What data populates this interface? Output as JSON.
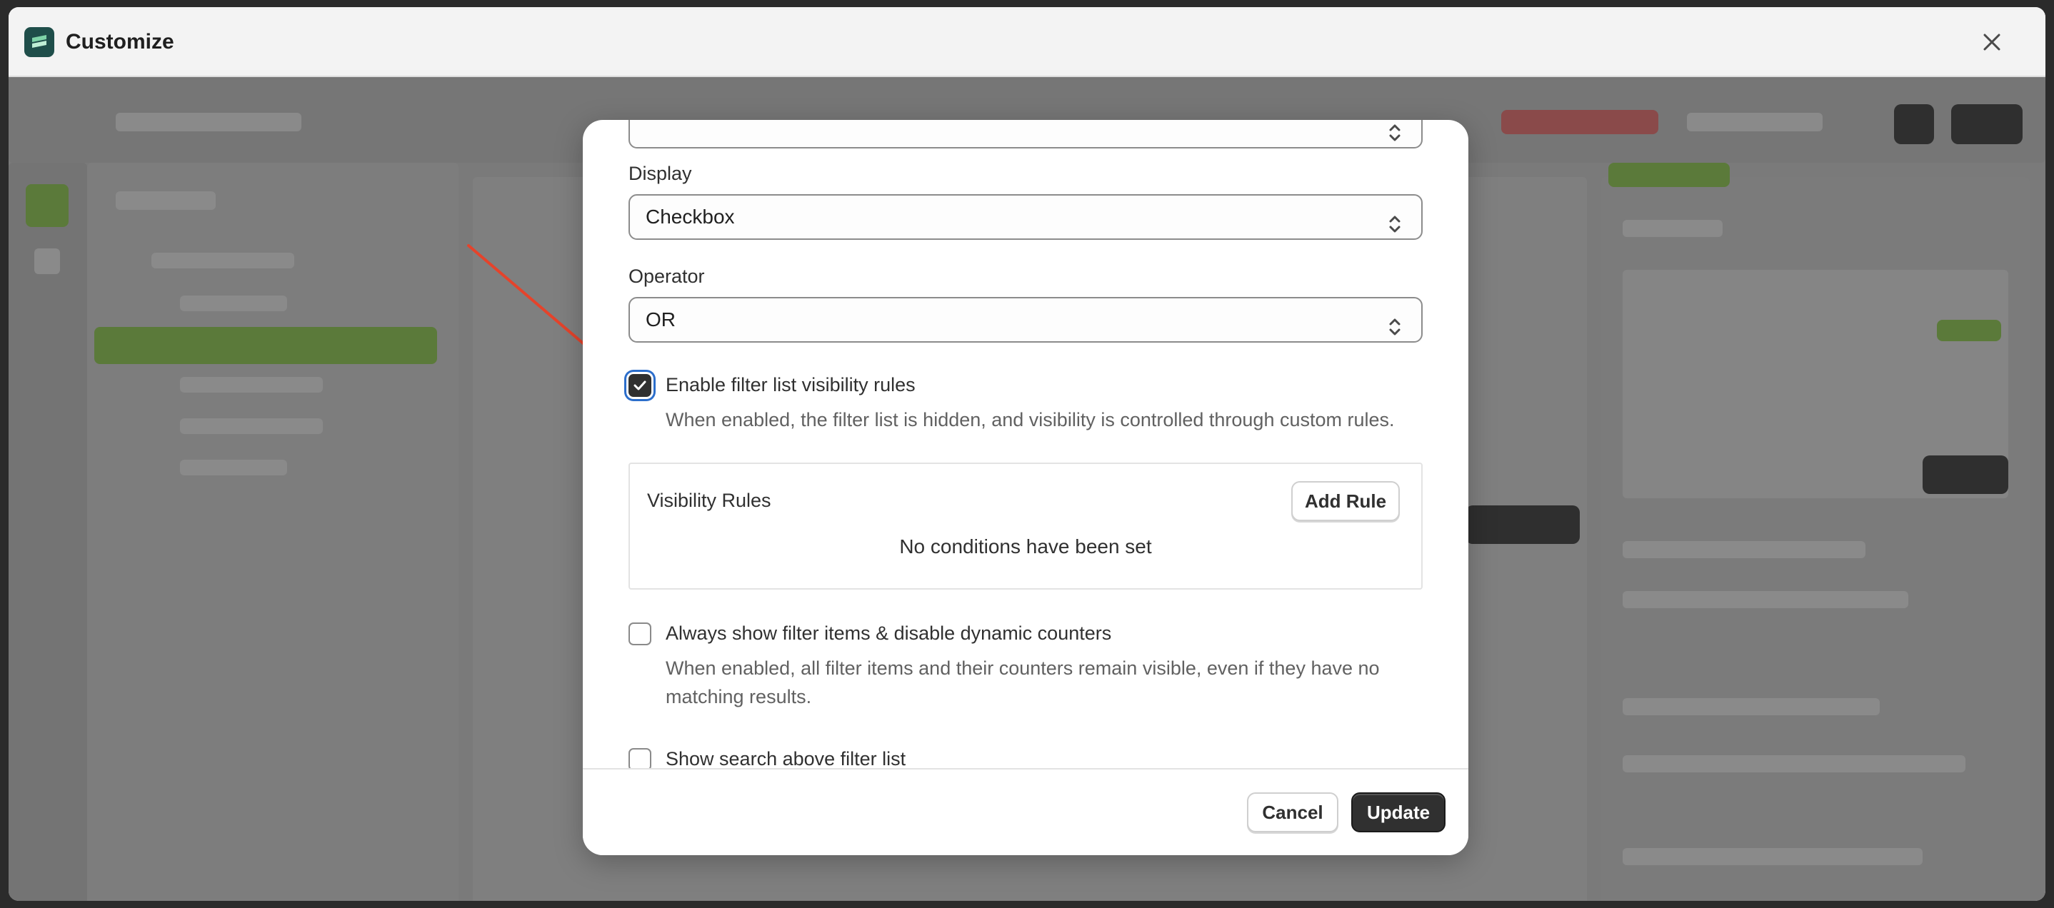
{
  "window": {
    "title": "Customize",
    "close_icon": "close-icon",
    "logo_icon": "app-logo-icon"
  },
  "modal": {
    "fields": {
      "display_label": "Display",
      "display_value": "Checkbox",
      "operator_label": "Operator",
      "operator_value": "OR"
    },
    "visibility_checkbox": {
      "label": "Enable filter list visibility rules",
      "checked": true,
      "help": "When enabled, the filter list is hidden, and visibility is controlled through custom rules."
    },
    "visibility_rules": {
      "title": "Visibility Rules",
      "add_button": "Add Rule",
      "empty_text": "No conditions have been set"
    },
    "always_show_checkbox": {
      "label": "Always show filter items & disable dynamic counters",
      "checked": false,
      "help": "When enabled, all filter items and their counters remain visible, even if they have no matching results."
    },
    "search_checkbox": {
      "label": "Show search above filter list",
      "checked": false
    },
    "footer": {
      "cancel": "Cancel",
      "update": "Update"
    }
  },
  "colors": {
    "annotation_arrow": "#e5432b",
    "focus_ring": "#2c6ecb",
    "primary_button": "#303030",
    "app_logo": "#1f4e4a"
  }
}
